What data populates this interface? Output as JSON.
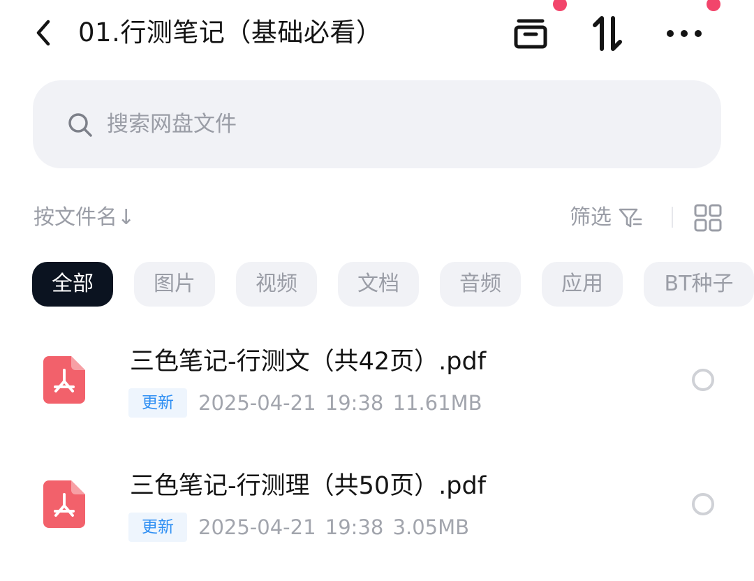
{
  "header": {
    "title": "01.行测笔记（基础必看）",
    "back_icon": "chevron-left-icon",
    "archive_icon": "archive-box-icon",
    "sort_icon": "transfer-arrows-icon",
    "more_icon": "more-dots-icon",
    "notification_dot_color": "#f2456b"
  },
  "search": {
    "placeholder": "搜索网盘文件",
    "icon": "search-icon"
  },
  "toolbar": {
    "sort_label": "按文件名↓",
    "filter_label": "筛选",
    "filter_icon": "filter-icon",
    "view_icon": "grid-view-icon"
  },
  "categories": [
    {
      "label": "全部",
      "active": true
    },
    {
      "label": "图片",
      "active": false
    },
    {
      "label": "视频",
      "active": false
    },
    {
      "label": "文档",
      "active": false
    },
    {
      "label": "音频",
      "active": false
    },
    {
      "label": "应用",
      "active": false
    },
    {
      "label": "BT种子",
      "active": false
    }
  ],
  "files": [
    {
      "name": "三色笔记-行测文（共42页）.pdf",
      "badge": "更新",
      "date": "2025-04-21",
      "time": "19:38",
      "size": "11.61MB",
      "icon": "pdf-file-icon"
    },
    {
      "name": "三色笔记-行测理（共50页）.pdf",
      "badge": "更新",
      "date": "2025-04-21",
      "time": "19:38",
      "size": "3.05MB",
      "icon": "pdf-file-icon"
    }
  ],
  "colors": {
    "active_chip_bg": "#0b1320",
    "chip_bg": "#f1f2f6",
    "badge_text": "#2f8ff3",
    "pdf_icon": "#f2616b"
  }
}
